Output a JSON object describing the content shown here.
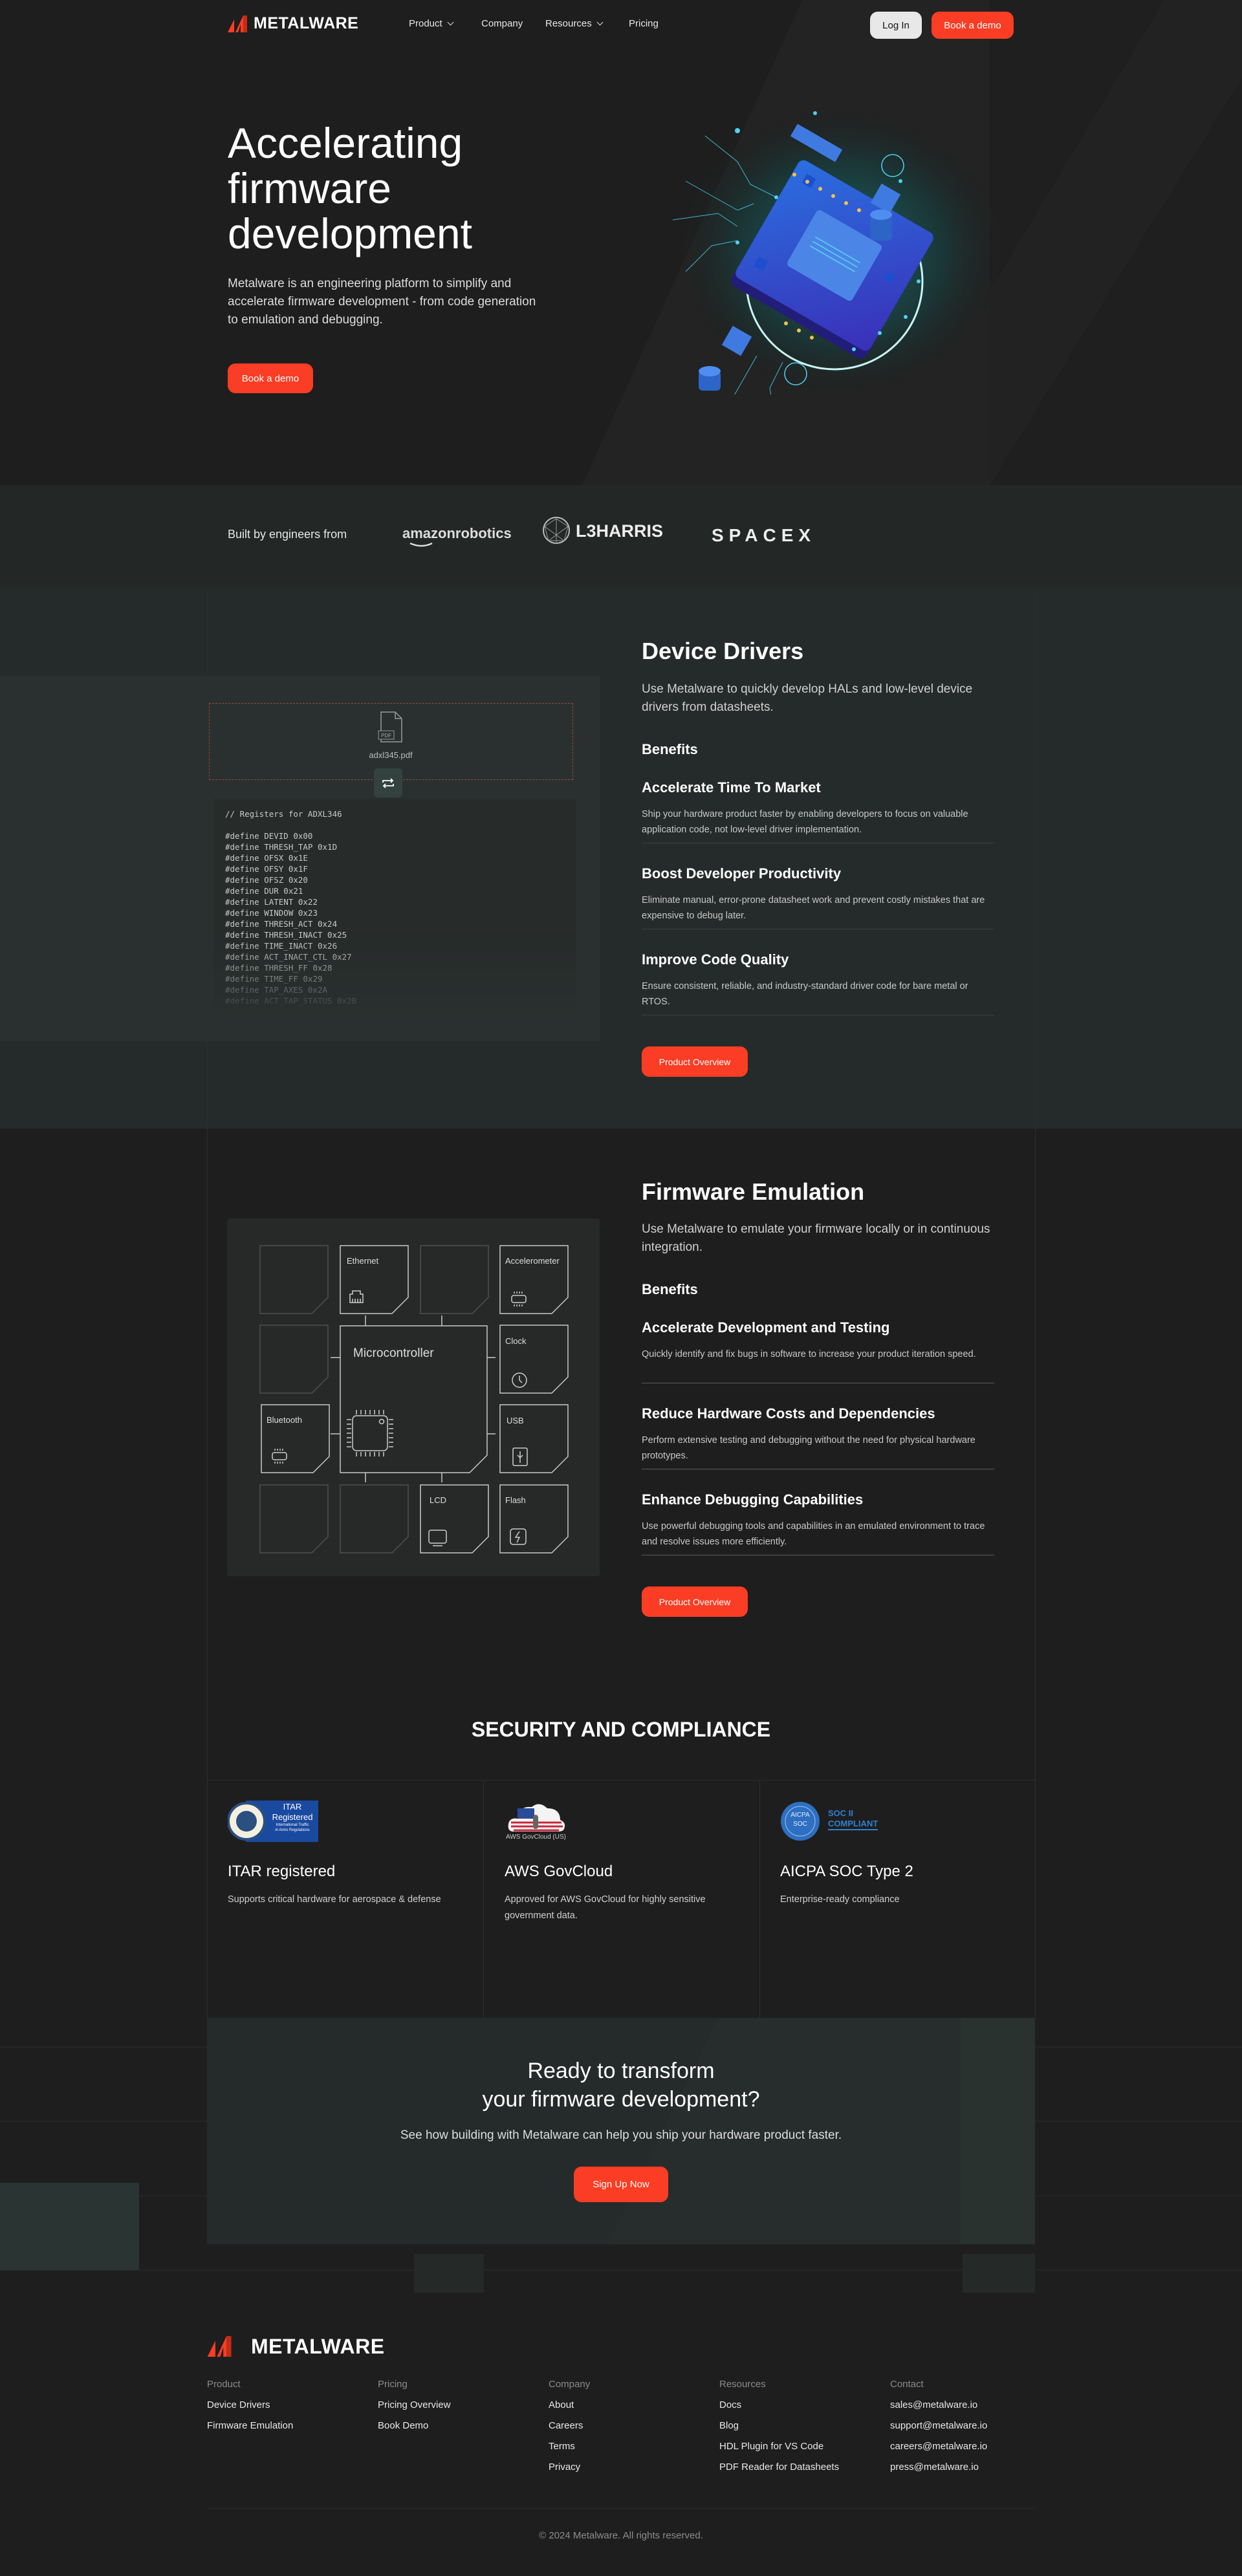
{
  "brand": {
    "name": "METALWARE",
    "accent": "#fa3d24"
  },
  "nav": {
    "items": [
      {
        "label": "Product",
        "has_dropdown": true
      },
      {
        "label": "Company",
        "has_dropdown": false
      },
      {
        "label": "Resources",
        "has_dropdown": true
      },
      {
        "label": "Pricing",
        "has_dropdown": false
      }
    ],
    "login": "Log In",
    "book_demo": "Book a demo"
  },
  "hero": {
    "title_lines": [
      "Accelerating",
      "firmware",
      "development"
    ],
    "description": "Metalware is an engineering platform to simplify and accelerate firmware development - from code generation to emulation and debugging.",
    "cta": "Book a demo"
  },
  "logos": {
    "label": "Built by engineers from",
    "companies": [
      "amazonrobotics",
      "L3HARRIS",
      "SPACEX"
    ]
  },
  "device_drivers": {
    "title": "Device Drivers",
    "description": "Use Metalware to quickly develop HALs and low-level device drivers from datasheets.",
    "benefits_label": "Benefits",
    "benefits": [
      {
        "title": "Accelerate Time To Market",
        "desc": "Ship your hardware product faster by enabling developers to focus on valuable application code, not low-level driver implementation."
      },
      {
        "title": "Boost Developer Productivity",
        "desc": "Eliminate manual, error-prone datasheet work and prevent costly mistakes that are expensive to debug later."
      },
      {
        "title": "Improve Code Quality",
        "desc": "Ensure consistent, reliable, and industry-standard driver code for bare metal or RTOS."
      }
    ],
    "cta": "Product Overview",
    "file_name": "adxl345.pdf",
    "file_icon_label": "PDF",
    "code": [
      "// Registers for ADXL346",
      "",
      "#define DEVID 0x00",
      "#define THRESH_TAP 0x1D",
      "#define OFSX 0x1E",
      "#define OFSY 0x1F",
      "#define OFSZ 0x20",
      "#define DUR 0x21",
      "#define LATENT 0x22",
      "#define WINDOW 0x23",
      "#define THRESH_ACT 0x24",
      "#define THRESH_INACT 0x25",
      "#define TIME_INACT 0x26",
      "#define ACT_INACT_CTL 0x27",
      "#define THRESH_FF 0x28",
      "#define TIME_FF 0x29",
      "#define TAP_AXES 0x2A",
      "#define ACT_TAP_STATUS 0x2B"
    ]
  },
  "emulation": {
    "title": "Firmware Emulation",
    "description": "Use Metalware to emulate your firmware locally or in continuous integration.",
    "benefits_label": "Benefits",
    "benefits": [
      {
        "title": "Accelerate Development and Testing",
        "desc": "Quickly identify and fix bugs in software to increase your product iteration speed."
      },
      {
        "title": "Reduce Hardware Costs and Dependencies",
        "desc": "Perform extensive testing and debugging without the need for physical hardware prototypes."
      },
      {
        "title": "Enhance Debugging Capabilities",
        "desc": "Use powerful debugging tools and capabilities in an emulated environment to trace and resolve issues more efficiently."
      }
    ],
    "cta": "Product Overview",
    "diagram": {
      "center": "Microcontroller",
      "peripherals": {
        "ethernet": "Ethernet",
        "accelerometer": "Accelerometer",
        "clock": "Clock",
        "bluetooth": "Bluetooth",
        "usb": "USB",
        "lcd": "LCD",
        "flash": "Flash"
      }
    }
  },
  "security": {
    "title": "SECURITY AND COMPLIANCE",
    "cards": [
      {
        "title": "ITAR registered",
        "desc": "Supports critical hardware for aerospace & defense",
        "logo_text": [
          "ITAR",
          "Registered",
          "International Traffic",
          "in Arms Regulations"
        ]
      },
      {
        "title": "AWS GovCloud",
        "desc": "Approved for AWS GovCloud for highly sensitive government data.",
        "logo_text": [
          "AWS GovCloud (US)"
        ]
      },
      {
        "title": "AICPA SOC Type 2",
        "desc": "Enterprise-ready compliance",
        "logo_text": [
          "AICPA",
          "SOC",
          "SOC II",
          "COMPLIANT"
        ]
      }
    ]
  },
  "cta": {
    "title_lines": [
      "Ready to transform",
      "your firmware development?"
    ],
    "subtitle": "See how building with Metalware can help you ship your hardware product faster.",
    "button": "Sign Up Now"
  },
  "footer": {
    "columns": [
      {
        "heading": "Product",
        "items": [
          "Device Drivers",
          "Firmware Emulation"
        ]
      },
      {
        "heading": "Pricing",
        "items": [
          "Pricing Overview",
          "Book Demo"
        ]
      },
      {
        "heading": "Company",
        "items": [
          "About",
          "Careers",
          "Terms",
          "Privacy"
        ]
      },
      {
        "heading": "Resources",
        "items": [
          "Docs",
          "Blog",
          "HDL Plugin for VS Code",
          "PDF Reader for Datasheets"
        ]
      },
      {
        "heading": "Contact",
        "items": [
          "sales@metalware.io",
          "support@metalware.io",
          "careers@metalware.io",
          "press@metalware.io"
        ]
      }
    ],
    "copyright": "© 2024 Metalware. All rights reserved."
  }
}
